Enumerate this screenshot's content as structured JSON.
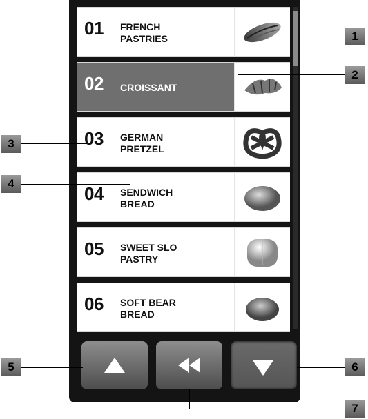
{
  "menu": {
    "items": [
      {
        "number": "01",
        "line1": "FRENCH",
        "line2": "PASTRIES",
        "image": "pain-au-chocolat-image"
      },
      {
        "number": "02",
        "line1": "CROISSANT",
        "line2": "",
        "image": "croissant-image",
        "selected": true
      },
      {
        "number": "03",
        "line1": "GERMAN",
        "line2": "PRETZEL",
        "image": "pretzel-image"
      },
      {
        "number": "04",
        "line1": "SENDWICH",
        "line2": "BREAD",
        "image": "sandwich-bread-image"
      },
      {
        "number": "05",
        "line1": "SWEET SLO",
        "line2": "PASTRY",
        "image": "sweet-pastry-image"
      },
      {
        "number": "06",
        "line1": "SOFT BEAR",
        "line2": "BREAD",
        "image": "soft-bread-image"
      }
    ]
  },
  "buttons": {
    "up": "up-arrow-icon",
    "back": "rewind-icon",
    "down": "down-arrow-icon"
  },
  "callouts": [
    "1",
    "2",
    "3",
    "4",
    "5",
    "6",
    "7"
  ]
}
